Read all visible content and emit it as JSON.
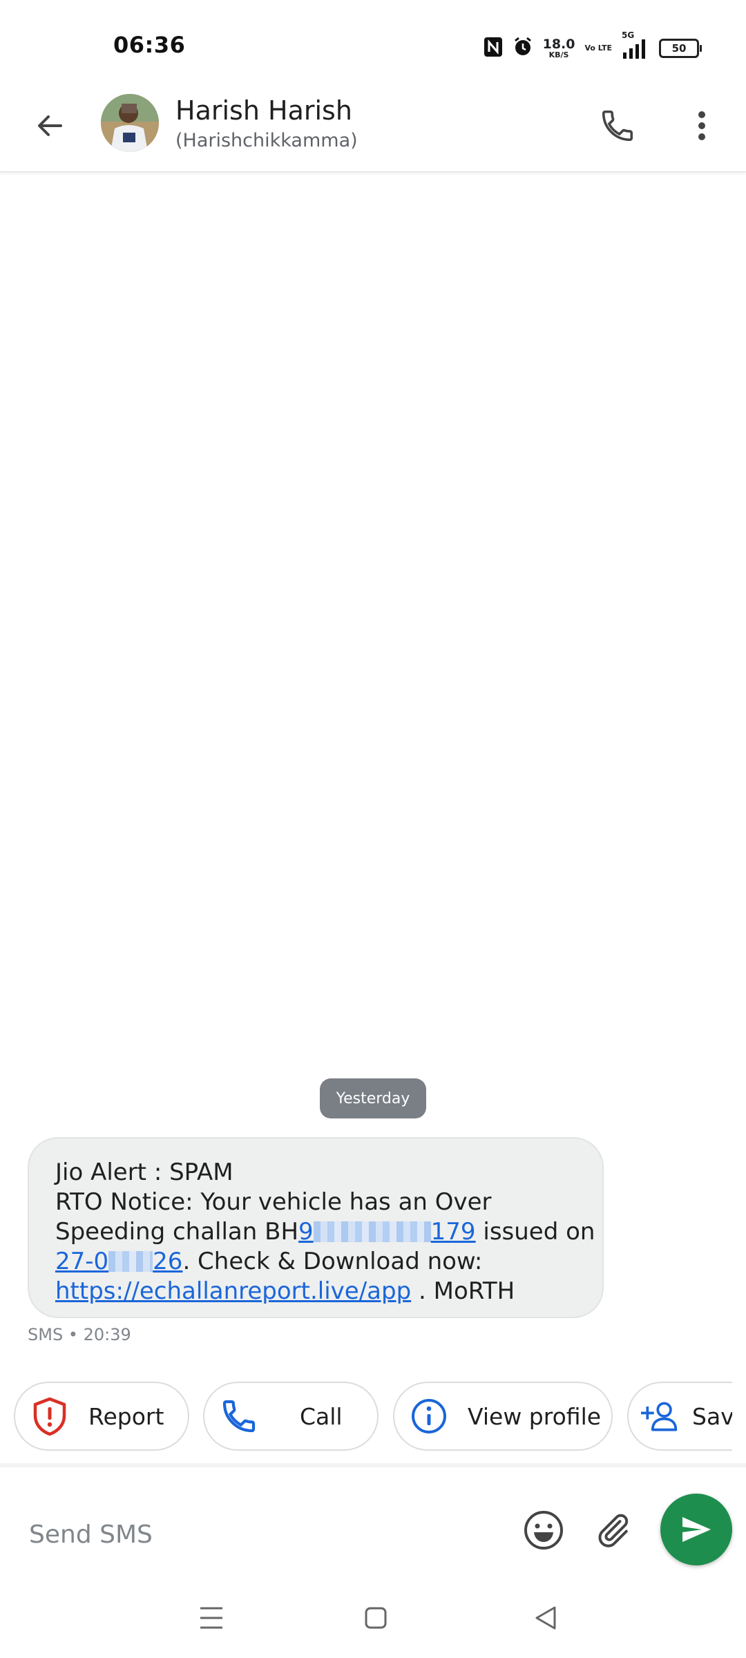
{
  "status_bar": {
    "time": "06:36",
    "net_speed_value": "18.0",
    "net_speed_unit": "KB/S",
    "volte": "Vo LTE",
    "network": "5G",
    "battery": "50",
    "icons": [
      "nfc-icon",
      "alarm-icon",
      "signal-icon",
      "battery-icon"
    ]
  },
  "header": {
    "contact_name": "Harish Harish",
    "contact_sub": "(Harishchikkamma)",
    "icons": [
      "back-arrow-icon",
      "phone-icon",
      "more-vert-icon"
    ]
  },
  "conversation": {
    "date_chip": "Yesterday",
    "message": {
      "line1": "Jio Alert : SPAM",
      "line2": "RTO Notice: Your vehicle has an Over",
      "line3_pre": "Speeding challan BH",
      "line3_link_a": "9",
      "line3_link_b": "179",
      "line3_post": " issued on",
      "line4_link_a": "27-0",
      "line4_link_b": "26",
      "line4_post": ". Check & Download now:",
      "line5_link": "https://echallanreport.live/app",
      "line5_post": " . MoRTH",
      "meta": "SMS • 20:39"
    }
  },
  "suggestions": [
    {
      "label": "Report",
      "icon": "shield-alert-icon"
    },
    {
      "label": "Call",
      "icon": "phone-icon"
    },
    {
      "label": "View profile",
      "icon": "info-icon"
    },
    {
      "label": "Sav",
      "icon": "person-add-icon"
    }
  ],
  "compose": {
    "placeholder": "Send SMS",
    "icons": [
      "emoji-icon",
      "attach-icon",
      "send-icon"
    ]
  },
  "nav_bar": {
    "icons": [
      "recents-icon",
      "home-icon",
      "back-icon"
    ]
  },
  "colors": {
    "link": "#1a66d9",
    "send_button": "#1e8e4e",
    "report_red": "#d93025",
    "chip_icon_blue": "#1a66d9"
  }
}
